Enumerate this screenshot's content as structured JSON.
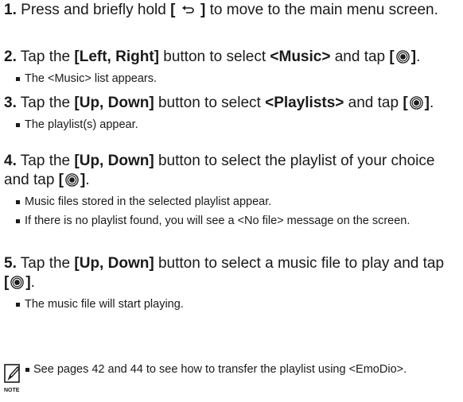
{
  "steps": [
    {
      "num": "1.",
      "parts": [
        {
          "t": "Press and briefly hold "
        },
        {
          "t": "[ ",
          "b": true
        },
        {
          "icon": "back-icon"
        },
        {
          "t": " ]",
          "b": true
        },
        {
          "t": " to move to the main menu screen."
        }
      ],
      "bullets": []
    },
    {
      "num": "2.",
      "parts": [
        {
          "t": "Tap the "
        },
        {
          "t": "[Left, Right]",
          "b": true
        },
        {
          "t": " button to select "
        },
        {
          "t": "<Music>",
          "b": true
        },
        {
          "t": " and tap "
        },
        {
          "t": "[",
          "b": true
        },
        {
          "icon": "select-button-icon"
        },
        {
          "t": "]",
          "b": true
        },
        {
          "t": "."
        }
      ],
      "bullets": [
        "The <Music> list appears."
      ]
    },
    {
      "num": "3.",
      "parts": [
        {
          "t": "Tap the "
        },
        {
          "t": "[Up, Down]",
          "b": true
        },
        {
          "t": " button to select "
        },
        {
          "t": "<Playlists>",
          "b": true
        },
        {
          "t": " and tap "
        },
        {
          "t": "[",
          "b": true
        },
        {
          "icon": "select-button-icon"
        },
        {
          "t": "]",
          "b": true
        },
        {
          "t": "."
        }
      ],
      "bullets": [
        "The playlist(s) appear."
      ]
    },
    {
      "num": "4.",
      "parts": [
        {
          "t": "Tap the "
        },
        {
          "t": "[Up, Down]",
          "b": true
        },
        {
          "t": " button to select the playlist of your choice and tap "
        },
        {
          "t": "[",
          "b": true
        },
        {
          "icon": "select-button-icon"
        },
        {
          "t": "]",
          "b": true
        },
        {
          "t": "."
        }
      ],
      "bullets": [
        "Music files stored in the selected playlist appear.",
        "If there is no playlist found, you will see a <No file> message on the screen."
      ]
    },
    {
      "num": "5.",
      "parts": [
        {
          "t": "Tap the "
        },
        {
          "t": "[Up, Down]",
          "b": true
        },
        {
          "t": " button to select a music file to play and tap "
        },
        {
          "t": "[",
          "b": true
        },
        {
          "icon": "select-button-icon"
        },
        {
          "t": "]",
          "b": true
        },
        {
          "t": "."
        }
      ],
      "bullets": [
        "The music file will start playing."
      ]
    }
  ],
  "note": {
    "icon": "note-pencil-icon",
    "label": "NOTE",
    "text": "See pages 42 and 44 to see how to transfer the playlist using <EmoDio>."
  }
}
